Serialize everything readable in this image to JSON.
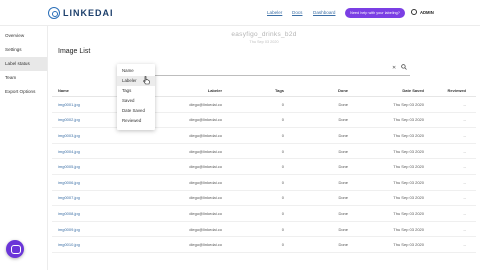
{
  "header": {
    "logo_text": "LINKEDAI",
    "nav": [
      "Labeler",
      "Docs",
      "Dashboard"
    ],
    "cta_label": "Need help with your labeling?",
    "user": "ADMIN"
  },
  "sidebar": {
    "items": [
      "Overview",
      "Settings",
      "Label status",
      "Team",
      "Export Options"
    ],
    "active_index": 2
  },
  "dataset": {
    "name": "easyfigo_drinks_b2d",
    "date": "Thu Sep 03 2020"
  },
  "main": {
    "title": "Image List",
    "filter_dropdown": {
      "options": [
        "Name",
        "Labeler",
        "Tags",
        "Saved",
        "Date Saved",
        "Reviewed"
      ],
      "hover_index": 1
    },
    "columns": [
      "Name",
      "Labeler",
      "Tags",
      "Done",
      "Date Saved",
      "Reviewed"
    ],
    "rows": [
      {
        "name": "img0001.jpg",
        "labeler": "diego@linkedai.co",
        "tags": "0",
        "done": "Done",
        "date": "Thu Sep 03 2020",
        "reviewed": "--"
      },
      {
        "name": "img0002.jpg",
        "labeler": "diego@linkedai.co",
        "tags": "0",
        "done": "Done",
        "date": "Thu Sep 03 2020",
        "reviewed": "--"
      },
      {
        "name": "img0003.jpg",
        "labeler": "diego@linkedai.co",
        "tags": "0",
        "done": "Done",
        "date": "Thu Sep 03 2020",
        "reviewed": "--"
      },
      {
        "name": "img0004.jpg",
        "labeler": "diego@linkedai.co",
        "tags": "0",
        "done": "Done",
        "date": "Thu Sep 03 2020",
        "reviewed": "--"
      },
      {
        "name": "img0005.jpg",
        "labeler": "diego@linkedai.co",
        "tags": "0",
        "done": "Done",
        "date": "Thu Sep 03 2020",
        "reviewed": "--"
      },
      {
        "name": "img0006.jpg",
        "labeler": "diego@linkedai.co",
        "tags": "0",
        "done": "Done",
        "date": "Thu Sep 03 2020",
        "reviewed": "--"
      },
      {
        "name": "img0007.jpg",
        "labeler": "diego@linkedai.co",
        "tags": "0",
        "done": "Done",
        "date": "Thu Sep 03 2020",
        "reviewed": "--"
      },
      {
        "name": "img0008.jpg",
        "labeler": "diego@linkedai.co",
        "tags": "0",
        "done": "Done",
        "date": "Thu Sep 03 2020",
        "reviewed": "--"
      },
      {
        "name": "img0009.jpg",
        "labeler": "diego@linkedai.co",
        "tags": "0",
        "done": "Done",
        "date": "Thu Sep 03 2020",
        "reviewed": "--"
      },
      {
        "name": "img0010.jpg",
        "labeler": "diego@linkedai.co",
        "tags": "0",
        "done": "Done",
        "date": "Thu Sep 03 2020",
        "reviewed": "--"
      }
    ]
  },
  "colors": {
    "accent": "#7b3fe4",
    "link": "#3a6ea5",
    "brand": "#2b6fb8"
  },
  "icons": {
    "logo": "linkedai-logo-icon",
    "user": "user-icon",
    "clear": "close-icon",
    "filter": "search-icon",
    "chat": "chat-icon",
    "pointer": "hand-cursor-icon"
  }
}
